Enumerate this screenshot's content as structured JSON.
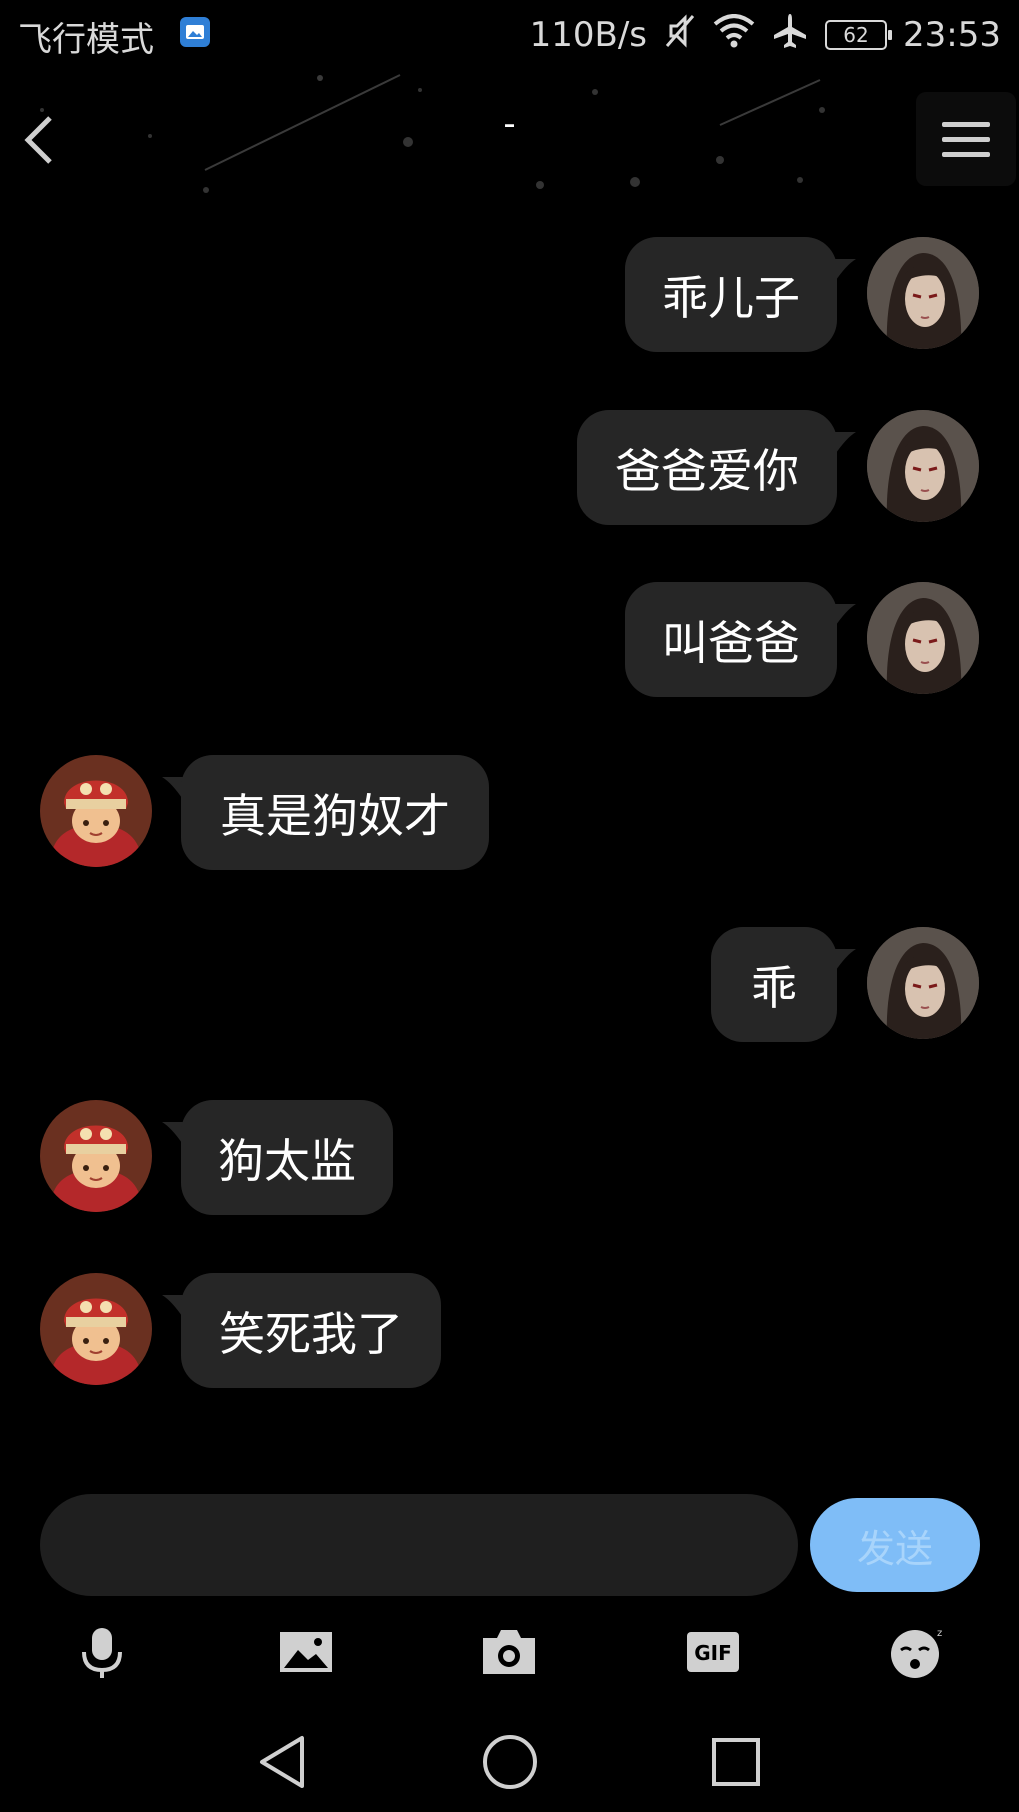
{
  "status_bar": {
    "carrier_text": "飞行模式",
    "net_speed": "110B/s",
    "battery_level": "62",
    "time": "23:53"
  },
  "header": {
    "title": "-"
  },
  "messages": [
    {
      "side": "right",
      "text": "乖儿子"
    },
    {
      "side": "right",
      "text": "爸爸爱你"
    },
    {
      "side": "right",
      "text": "叫爸爸"
    },
    {
      "side": "left",
      "text": "真是狗奴才"
    },
    {
      "side": "right",
      "text": "乖"
    },
    {
      "side": "left",
      "text": "狗太监"
    },
    {
      "side": "left",
      "text": "笑死我了"
    }
  ],
  "composer": {
    "input_value": "",
    "send_label": "发送"
  },
  "toolbar": {
    "items": [
      "microphone-icon",
      "image-icon",
      "camera-icon",
      "gif-icon",
      "emoji-icon"
    ],
    "gif_label": "GIF"
  },
  "colors": {
    "background": "#000000",
    "bubble": "#262626",
    "send_button": "#7fbdf7"
  }
}
